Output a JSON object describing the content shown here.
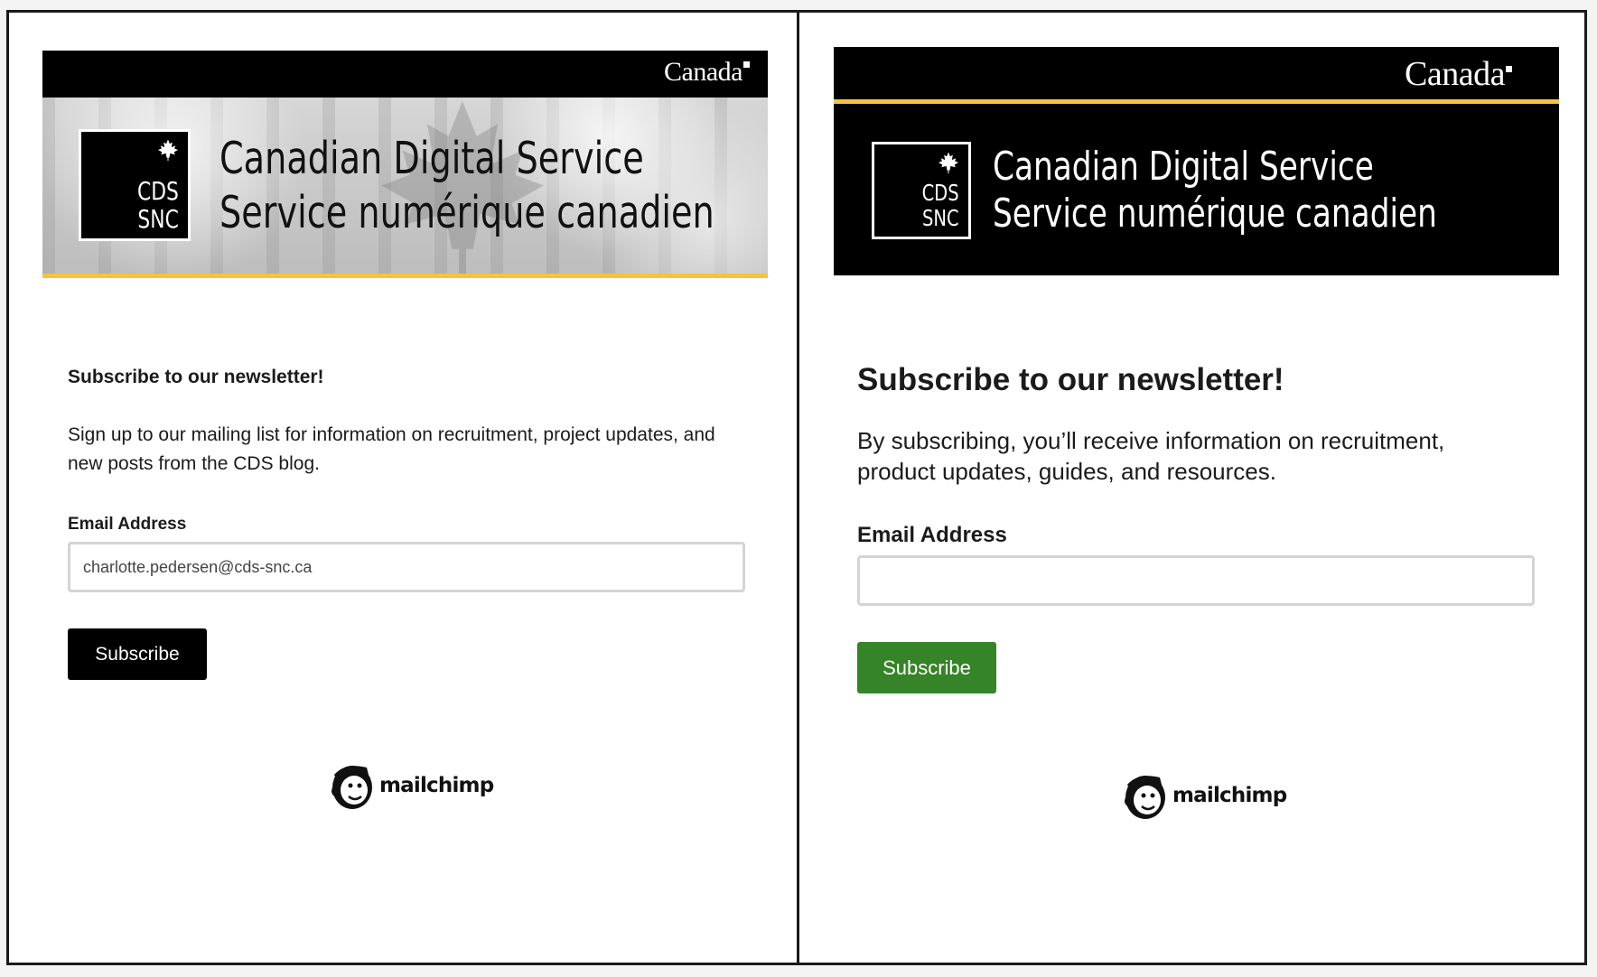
{
  "panels": [
    {
      "banner": {
        "wordmark": "Canada",
        "logo_line1": "CDS",
        "logo_line2": "SNC",
        "title_line1": "Canadian Digital Service",
        "title_line2": "Service numérique canadien"
      },
      "heading": "Subscribe to our newsletter!",
      "description": "Sign up to our mailing list for information on recruitment, project updates, and new posts from the CDS blog.",
      "email_label": "Email Address",
      "email_value": "charlotte.pedersen@cds-snc.ca",
      "button_label": "Subscribe",
      "footer_logo": "mailchimp"
    },
    {
      "banner": {
        "wordmark": "Canada",
        "logo_line1": "CDS",
        "logo_line2": "SNC",
        "title_line1": "Canadian Digital Service",
        "title_line2": "Service numérique canadien"
      },
      "heading": "Subscribe to our newsletter!",
      "description": "By subscribing, you’ll receive information on recruitment, product updates, guides, and resources.",
      "email_label": "Email Address",
      "email_value": "",
      "button_label": "Subscribe",
      "footer_logo": "mailchimp"
    }
  ],
  "colors": {
    "gold_accent": "#f5c242",
    "left_button": "#000000",
    "right_button": "#358427"
  },
  "icons": [
    "maple-leaf-icon",
    "mailchimp-freddie-icon"
  ]
}
